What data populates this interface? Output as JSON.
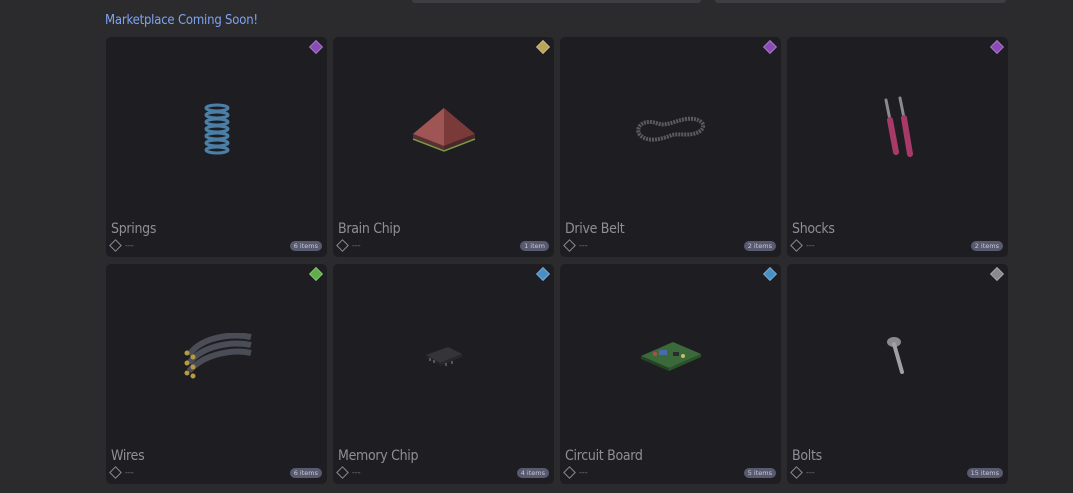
{
  "heading": "Marketplace Coming Soon!",
  "colors": {
    "heading": "#7ea3f0",
    "card_bg": "#1e1e22",
    "page_bg": "#2b2b2e"
  },
  "items": [
    {
      "name": "Springs",
      "price": "---",
      "count": "6 items",
      "rarity_color": "#8b4bb5",
      "icon": "spring-icon"
    },
    {
      "name": "Brain Chip",
      "price": "---",
      "count": "1 item",
      "rarity_color": "#b8a55a",
      "icon": "brain-chip-icon"
    },
    {
      "name": "Drive Belt",
      "price": "---",
      "count": "2 items",
      "rarity_color": "#8b4bb5",
      "icon": "drive-belt-icon"
    },
    {
      "name": "Shocks",
      "price": "---",
      "count": "2 items",
      "rarity_color": "#8b4bb5",
      "icon": "shocks-icon"
    },
    {
      "name": "Wires",
      "price": "---",
      "count": "6 items",
      "rarity_color": "#5fae4a",
      "icon": "wires-icon"
    },
    {
      "name": "Memory Chip",
      "price": "---",
      "count": "4 items",
      "rarity_color": "#4a8fc4",
      "icon": "memory-chip-icon"
    },
    {
      "name": "Circuit Board",
      "price": "---",
      "count": "5 items",
      "rarity_color": "#4a8fc4",
      "icon": "circuit-board-icon"
    },
    {
      "name": "Bolts",
      "price": "---",
      "count": "15 items",
      "rarity_color": "#8a8a8e",
      "icon": "bolt-icon"
    }
  ]
}
